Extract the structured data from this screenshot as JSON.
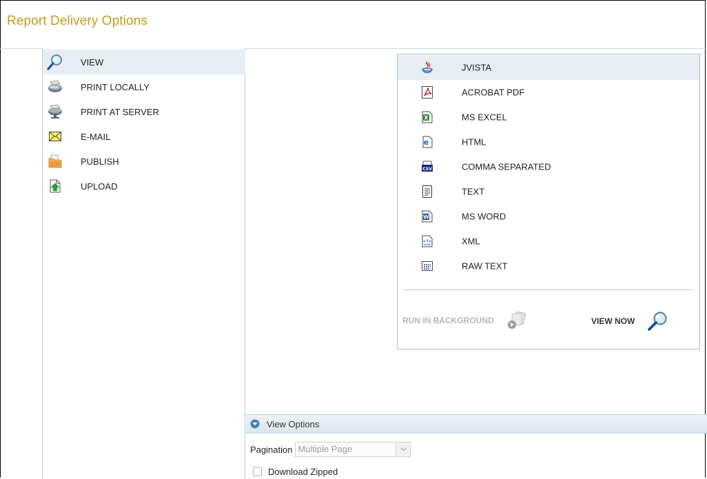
{
  "header": {
    "title": "Report Delivery Options"
  },
  "delivery": {
    "items": [
      {
        "label": "VIEW",
        "icon": "magnifier-icon"
      },
      {
        "label": "PRINT LOCALLY",
        "icon": "printer-icon"
      },
      {
        "label": "PRINT AT SERVER",
        "icon": "server-printer-icon"
      },
      {
        "label": "E-MAIL",
        "icon": "envelope-icon"
      },
      {
        "label": "PUBLISH",
        "icon": "folder-icon"
      },
      {
        "label": "UPLOAD",
        "icon": "upload-icon"
      }
    ],
    "selected": "VIEW"
  },
  "formats": {
    "items": [
      {
        "label": "JVISTA",
        "icon": "jvista-icon"
      },
      {
        "label": "ACROBAT PDF",
        "icon": "pdf-icon"
      },
      {
        "label": "MS EXCEL",
        "icon": "excel-icon"
      },
      {
        "label": "HTML",
        "icon": "html-icon"
      },
      {
        "label": "COMMA SEPARATED",
        "icon": "csv-icon"
      },
      {
        "label": "TEXT",
        "icon": "text-file-icon"
      },
      {
        "label": "MS WORD",
        "icon": "word-icon"
      },
      {
        "label": "XML",
        "icon": "xml-icon"
      },
      {
        "label": "RAW TEXT",
        "icon": "raw-text-icon"
      }
    ],
    "selected": "JVISTA",
    "run_background_label": "RUN IN BACKGROUND",
    "view_now_label": "VIEW NOW"
  },
  "view_options": {
    "header_label": "View Options",
    "pagination_label": "Pagination",
    "pagination_value": "Multiple Page",
    "download_zipped_label": "Download Zipped"
  },
  "colors": {
    "title": "#c79a1a",
    "selected_row": "#e6edf3",
    "border": "#b9ccd9"
  }
}
